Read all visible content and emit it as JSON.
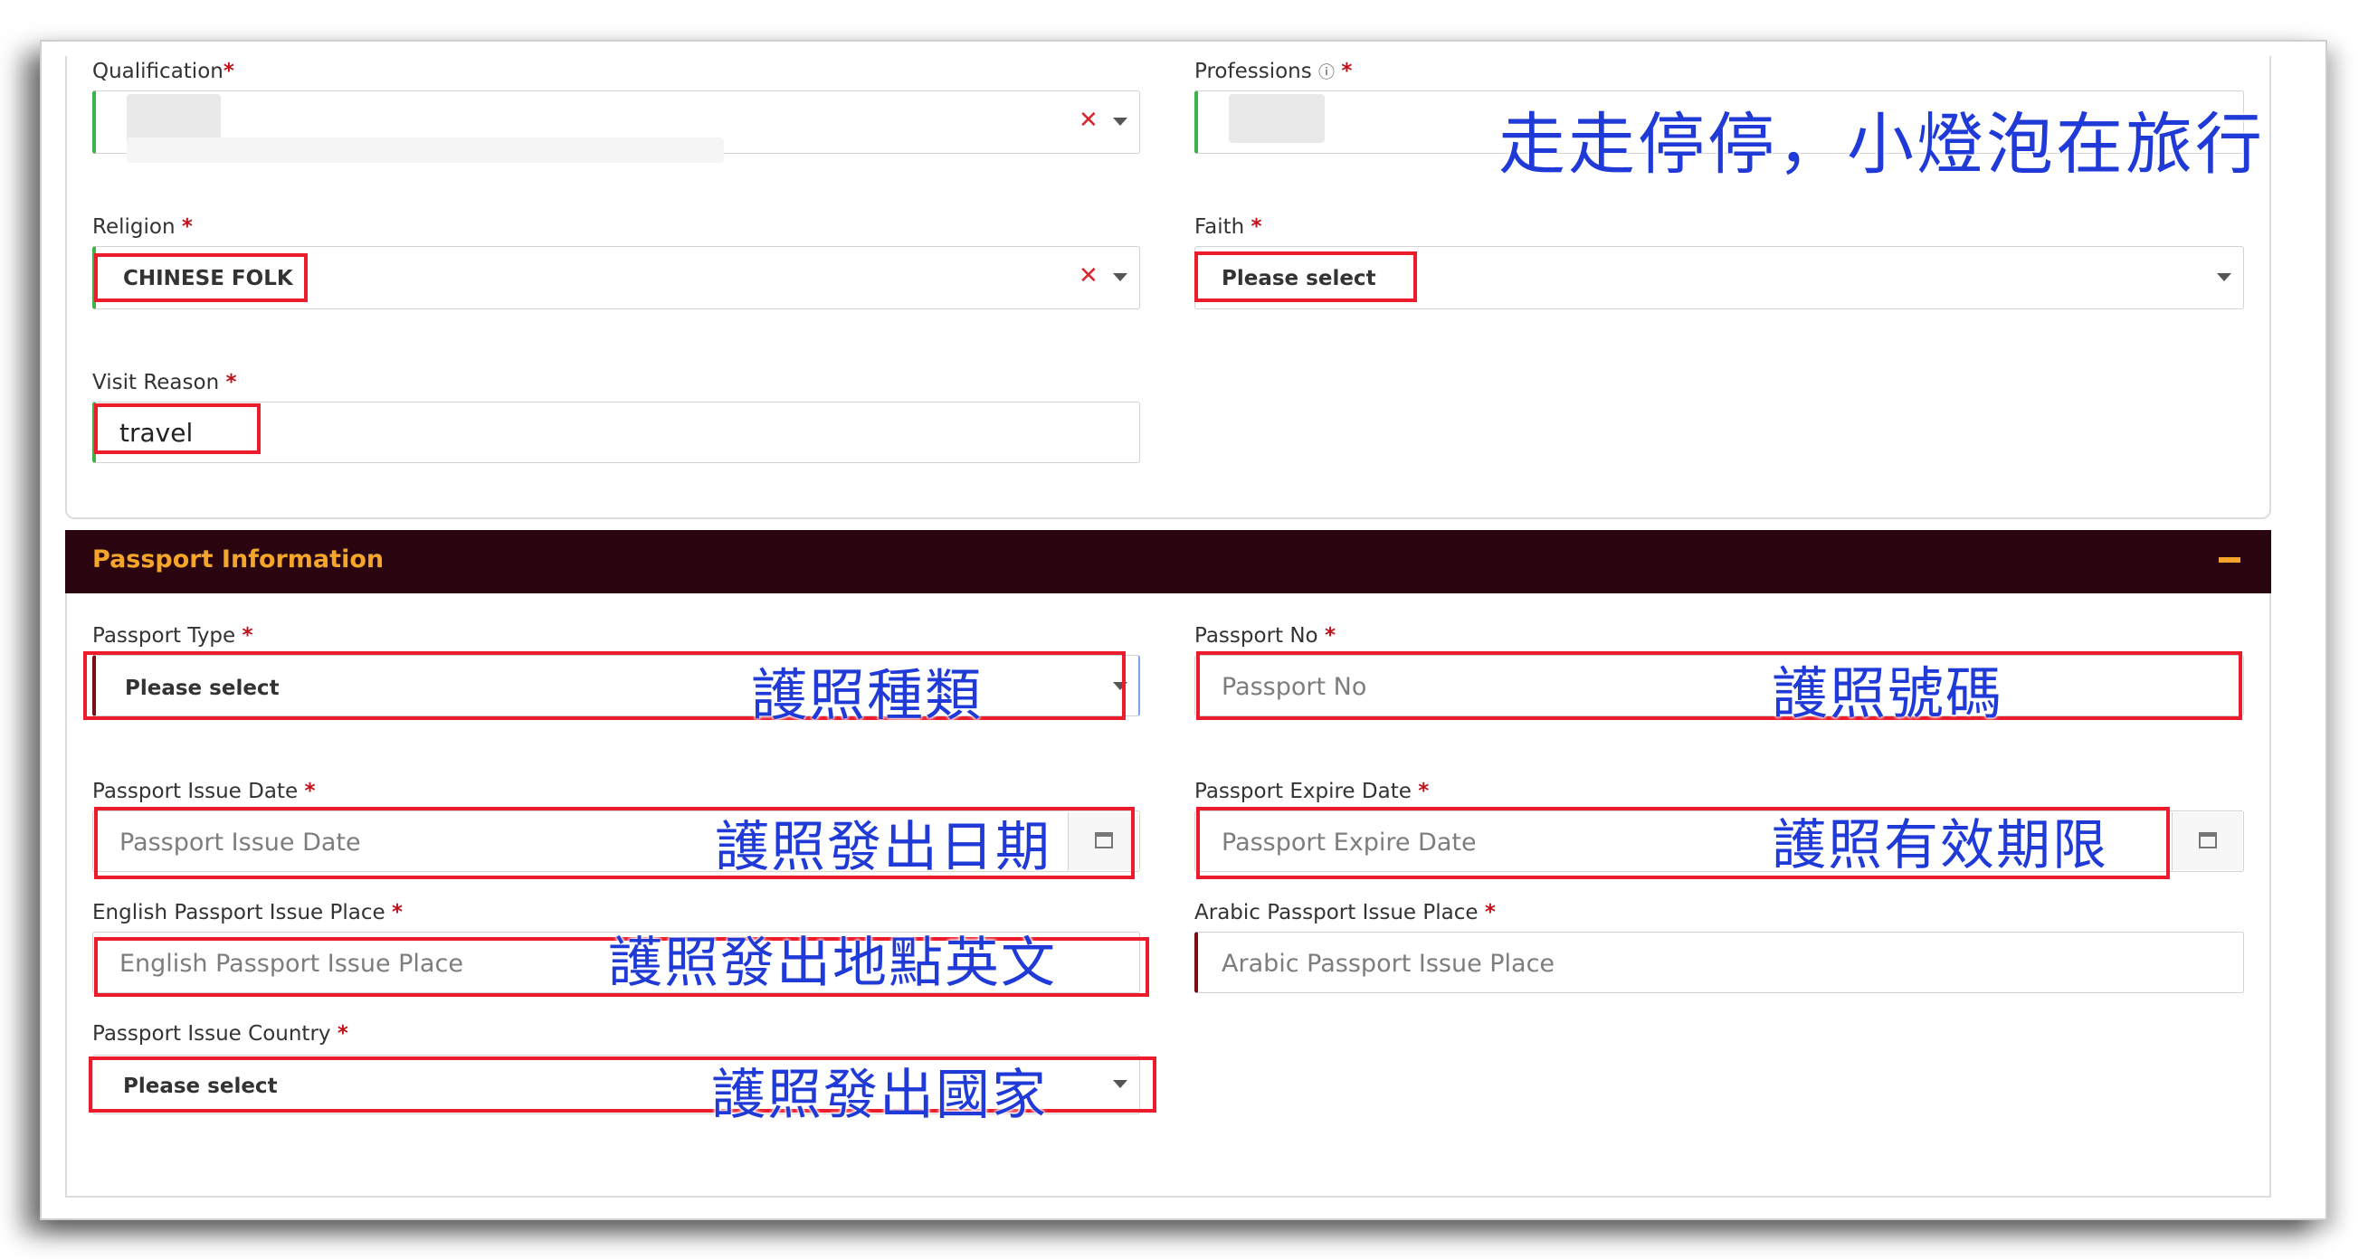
{
  "watermark": "走走停停，小燈泡在旅行",
  "required_mark": "*",
  "qualification": {
    "label": "Qualification"
  },
  "professions": {
    "label": "Professions",
    "info_icon": "info-icon"
  },
  "religion": {
    "label": "Religion",
    "value": "CHINESE FOLK"
  },
  "faith": {
    "label": "Faith",
    "value": "Please select"
  },
  "visit_reason": {
    "label": "Visit Reason",
    "value": "travel"
  },
  "passport_section": {
    "title": "Passport Information",
    "collapse_icon": "minus-icon"
  },
  "passport_type": {
    "label": "Passport Type",
    "value": "Please select",
    "note": "護照種類"
  },
  "passport_no": {
    "label": "Passport No",
    "placeholder": "Passport No",
    "note": "護照號碼"
  },
  "passport_issue_date": {
    "label": "Passport Issue Date",
    "placeholder": "Passport Issue Date",
    "note": "護照發出日期",
    "icon": "calendar-icon"
  },
  "passport_expire_date": {
    "label": "Passport Expire Date",
    "placeholder": "Passport Expire Date",
    "note": "護照有效期限",
    "icon": "calendar-icon"
  },
  "english_issue_place": {
    "label": "English Passport Issue Place",
    "placeholder": "English Passport Issue Place",
    "note": "護照發出地點英文"
  },
  "arabic_issue_place": {
    "label": "Arabic Passport Issue Place",
    "placeholder": "Arabic Passport Issue Place"
  },
  "passport_issue_country": {
    "label": "Passport Issue Country",
    "value": "Please select",
    "note": "護照發出國家"
  },
  "colors": {
    "accent": "#f4a62a",
    "section_bg": "#2a0510",
    "annotation_box": "#ec1c2c",
    "annotation_text": "#1f3ad6",
    "valid_border": "#3bb34a"
  }
}
